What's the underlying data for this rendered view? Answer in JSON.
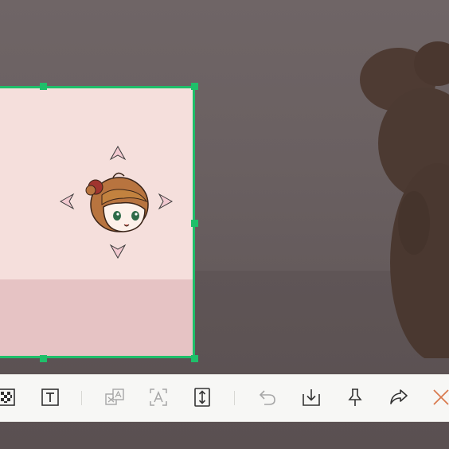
{
  "colors": {
    "selection_border": "#1fbf6a",
    "toolbar_bg": "#f7f7f5",
    "icon": "#333333",
    "icon_disabled": "#a6a6a6",
    "close": "#d97b4f"
  },
  "toolbar": {
    "tools": [
      {
        "name": "mosaic-tool",
        "icon": "mosaic-icon",
        "enabled": true
      },
      {
        "name": "text-tool",
        "icon": "text-box-icon",
        "enabled": true
      },
      {
        "name": "translate-tool",
        "icon": "translate-icon",
        "enabled": false
      },
      {
        "name": "ocr-text-tool",
        "icon": "ocr-text-icon",
        "enabled": false
      },
      {
        "name": "long-screenshot-tool",
        "icon": "scroll-capture-icon",
        "enabled": true
      },
      {
        "name": "undo-tool",
        "icon": "undo-icon",
        "enabled": false
      },
      {
        "name": "save-tool",
        "icon": "download-icon",
        "enabled": true
      },
      {
        "name": "pin-tool",
        "icon": "pin-icon",
        "enabled": true
      },
      {
        "name": "share-tool",
        "icon": "share-icon",
        "enabled": true
      },
      {
        "name": "close-tool",
        "icon": "close-icon",
        "enabled": true
      }
    ]
  }
}
